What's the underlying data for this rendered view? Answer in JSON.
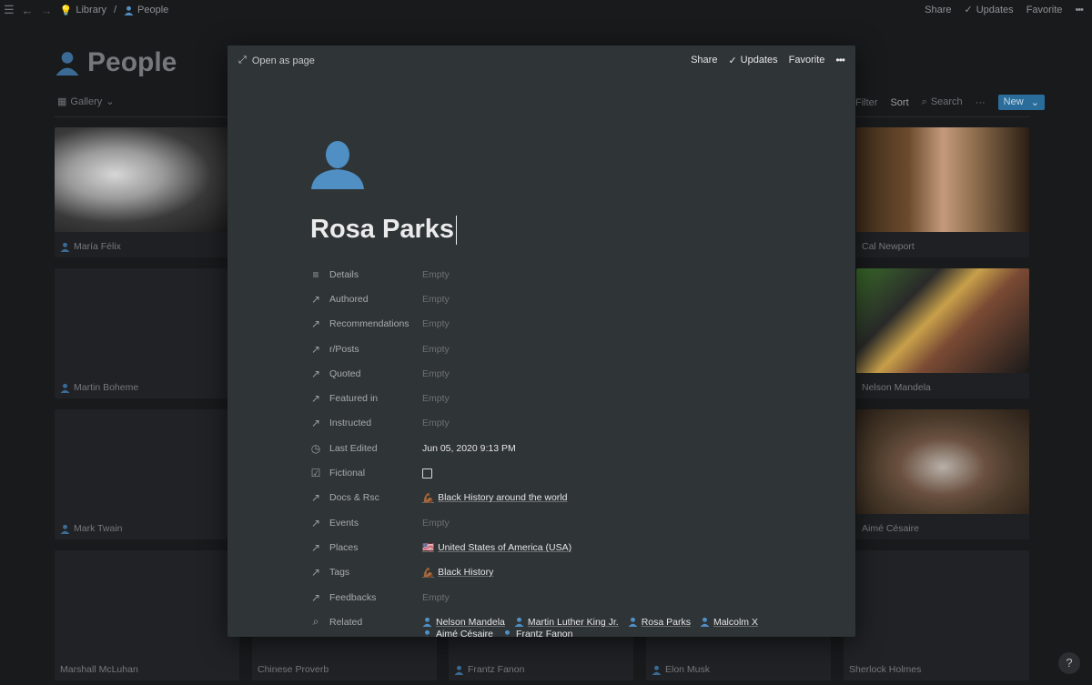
{
  "topbar": {
    "breadcrumb": [
      "Library",
      "People"
    ],
    "share": "Share",
    "updates": "Updates",
    "favorite": "Favorite",
    "more": "•••"
  },
  "background": {
    "title": "People",
    "view": "Gallery",
    "filter": "Filter",
    "sort": "Sort",
    "search": "Search",
    "more": "···",
    "new": "New",
    "cards": {
      "maria": "María Félix",
      "cal": "Cal Newport",
      "martin": "Martin Boheme",
      "nelson": "Nelson Mandela",
      "twain": "Mark Twain",
      "aime": "Aimé Césaire",
      "mcluhan": "Marshall McLuhan",
      "proverb": "Chinese Proverb",
      "fanon": "Frantz Fanon",
      "musk": "Elon Musk",
      "holmes": "Sherlock Holmes"
    }
  },
  "modal": {
    "open_as_page": "Open as page",
    "share": "Share",
    "updates": "Updates",
    "favorite": "Favorite",
    "more": "•••",
    "title": "Rosa Parks",
    "properties": [
      {
        "name": "Details",
        "value": "Empty",
        "icon": "text-lines-icon"
      },
      {
        "name": "Authored",
        "value": "Empty",
        "icon": "relation-arrow-icon"
      },
      {
        "name": "Recommendations",
        "value": "Empty",
        "icon": "relation-arrow-icon"
      },
      {
        "name": "r/Posts",
        "value": "Empty",
        "icon": "relation-arrow-icon"
      },
      {
        "name": "Quoted",
        "value": "Empty",
        "icon": "relation-arrow-icon"
      },
      {
        "name": "Featured in",
        "value": "Empty",
        "icon": "relation-arrow-icon"
      },
      {
        "name": "Instructed",
        "value": "Empty",
        "icon": "relation-arrow-icon"
      },
      {
        "name": "Last Edited",
        "value": "Jun 05, 2020 9:13 PM",
        "icon": "clock-icon"
      },
      {
        "name": "Fictional",
        "value": "",
        "icon": "checkbox-icon"
      },
      {
        "name": "Docs & Rsc",
        "value": "Black History around the world",
        "icon": "relation-arrow-icon"
      },
      {
        "name": "Events",
        "value": "Empty",
        "icon": "relation-arrow-icon"
      },
      {
        "name": "Places",
        "value": "United States of America (USA)",
        "icon": "relation-arrow-icon"
      },
      {
        "name": "Tags",
        "value": "Black History",
        "icon": "relation-arrow-icon"
      },
      {
        "name": "Feedbacks",
        "value": "Empty",
        "icon": "relation-arrow-icon"
      },
      {
        "name": "Related",
        "value": "",
        "icon": "search-icon"
      }
    ],
    "related": [
      "Nelson Mandela",
      "Martin Luther King Jr.",
      "Rosa Parks",
      "Malcolm X",
      "Aimé Césaire",
      "Frantz Fanon"
    ]
  },
  "help": "?"
}
